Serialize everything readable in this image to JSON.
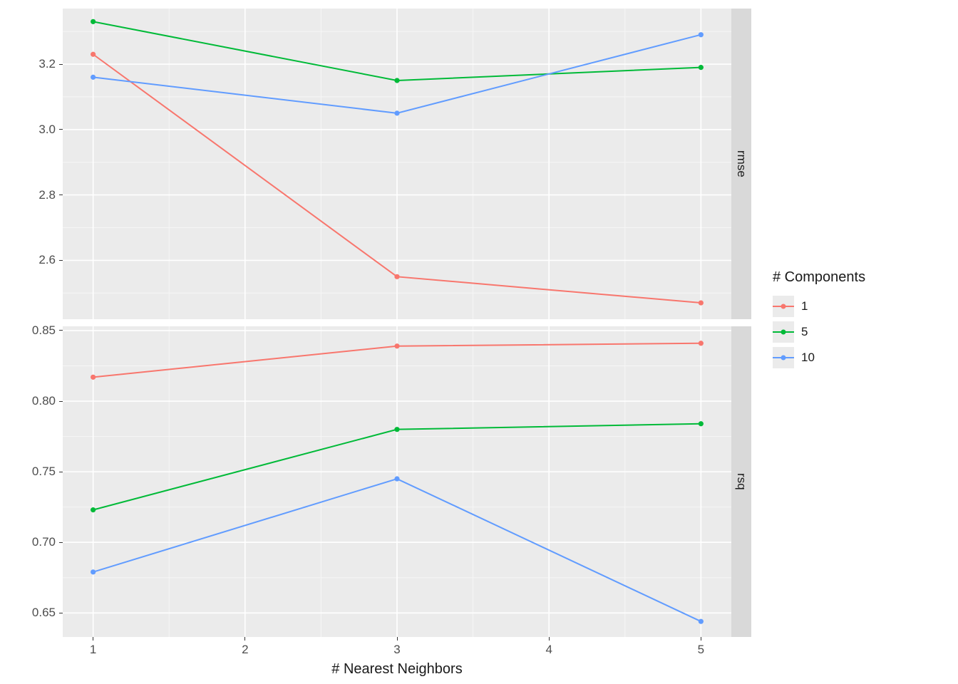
{
  "chart_data": [
    {
      "type": "line",
      "facet": "rmse",
      "xlabel": "# Nearest Neighbors",
      "ylabel": "",
      "x": [
        1,
        3,
        5
      ],
      "series": [
        {
          "name": "1",
          "color": "#f8766d",
          "values": [
            3.23,
            2.55,
            2.47
          ]
        },
        {
          "name": "5",
          "color": "#00ba38",
          "values": [
            3.33,
            3.15,
            3.19
          ]
        },
        {
          "name": "10",
          "color": "#619cff",
          "values": [
            3.16,
            3.05,
            3.29
          ]
        }
      ],
      "y_ticks": [
        2.6,
        2.8,
        3.0,
        3.2
      ],
      "x_ticks": [
        1,
        2,
        3,
        4,
        5
      ],
      "ylim": [
        2.42,
        3.37
      ],
      "xlim": [
        0.8,
        5.2
      ]
    },
    {
      "type": "line",
      "facet": "rsq",
      "xlabel": "# Nearest Neighbors",
      "ylabel": "",
      "x": [
        1,
        3,
        5
      ],
      "series": [
        {
          "name": "1",
          "color": "#f8766d",
          "values": [
            0.817,
            0.839,
            0.841
          ]
        },
        {
          "name": "5",
          "color": "#00ba38",
          "values": [
            0.723,
            0.78,
            0.784
          ]
        },
        {
          "name": "10",
          "color": "#619cff",
          "values": [
            0.679,
            0.745,
            0.644
          ]
        }
      ],
      "y_ticks": [
        0.65,
        0.7,
        0.75,
        0.8,
        0.85
      ],
      "x_ticks": [
        1,
        2,
        3,
        4,
        5
      ],
      "ylim": [
        0.633,
        0.853
      ],
      "xlim": [
        0.8,
        5.2
      ]
    }
  ],
  "legend": {
    "title": "# Components",
    "items": [
      {
        "label": "1",
        "color": "#f8766d"
      },
      {
        "label": "5",
        "color": "#00ba38"
      },
      {
        "label": "10",
        "color": "#619cff"
      }
    ]
  },
  "axis": {
    "x_title": "# Nearest Neighbors"
  },
  "facets": {
    "top": "rmse",
    "bottom": "rsq"
  },
  "y_tick_labels": {
    "top": [
      "2.6",
      "2.8",
      "3.0",
      "3.2"
    ],
    "bottom": [
      "0.65",
      "0.70",
      "0.75",
      "0.80",
      "0.85"
    ]
  },
  "x_tick_labels": [
    "1",
    "2",
    "3",
    "4",
    "5"
  ]
}
